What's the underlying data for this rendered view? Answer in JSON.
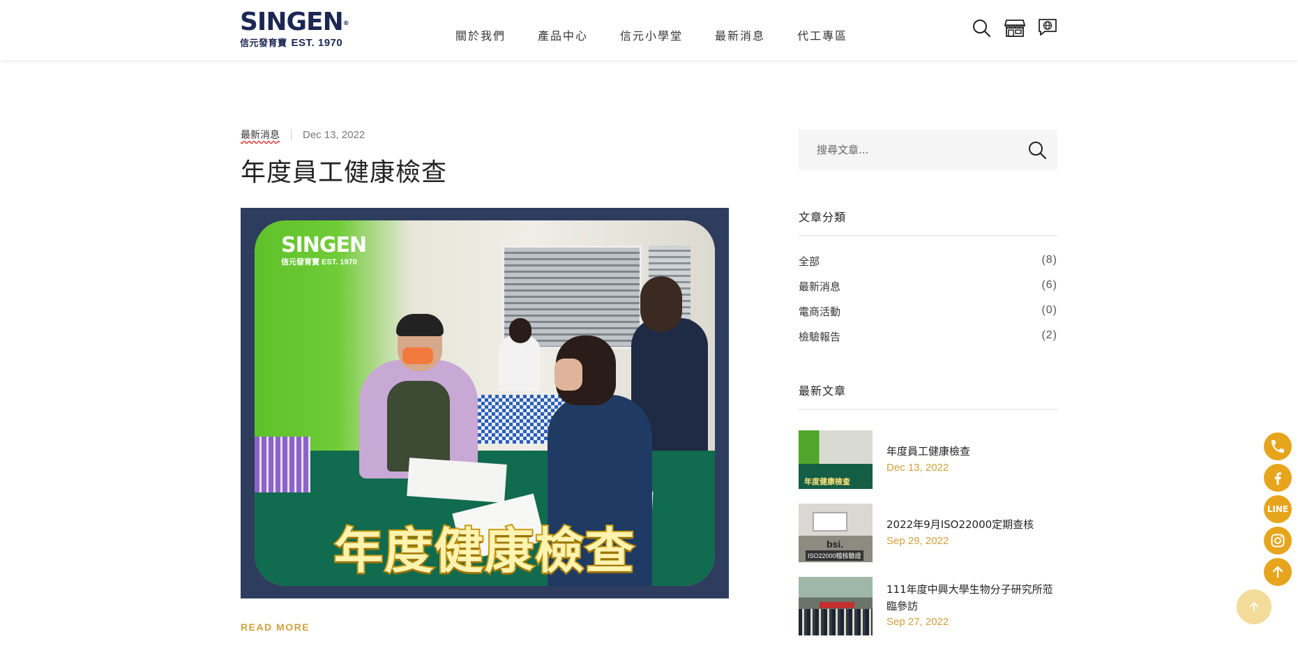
{
  "header": {
    "logo_brand": "SINGEN",
    "logo_sub": "信元發育寶",
    "logo_est": "EST. 1970",
    "nav": [
      "關於我們",
      "產品中心",
      "信元小學堂",
      "最新消息",
      "代工專區"
    ]
  },
  "post": {
    "category": "最新消息",
    "date": "Dec 13, 2022",
    "title": "年度員工健康檢查",
    "image_logo_brand": "SINGEN",
    "image_logo_sub": "信元發育寶  EST. 1970",
    "image_caption": "年度健康檢查",
    "read_more": "READ MORE"
  },
  "sidebar": {
    "search_placeholder": "搜尋文章...",
    "categories_heading": "文章分類",
    "categories": [
      {
        "label": "全部",
        "count": "(8)"
      },
      {
        "label": "最新消息",
        "count": "(6)"
      },
      {
        "label": "電商活動",
        "count": "(0)"
      },
      {
        "label": "檢驗報告",
        "count": "(2)"
      }
    ],
    "recent_heading": "最新文章",
    "recent": [
      {
        "title": "年度員工健康檢查",
        "date": "Dec 13, 2022",
        "thumb_text": "年度健康檢查"
      },
      {
        "title": "2022年9月ISO22000定期查核",
        "date": "Sep 29, 2022",
        "thumb_text": "bsi.",
        "thumb_sub": "ISO22000稽核驗證"
      },
      {
        "title": "111年度中興大學生物分子研究所蒞臨參訪",
        "date": "Sep 27, 2022"
      }
    ]
  },
  "floating": {
    "line_label": "LINE",
    "icons": [
      "phone-icon",
      "facebook-icon",
      "line-icon",
      "instagram-icon",
      "arrow-up-icon"
    ]
  },
  "colors": {
    "accent": "#e7a51d",
    "brand_navy": "#1c2753",
    "date_gold": "#d1a03b"
  }
}
